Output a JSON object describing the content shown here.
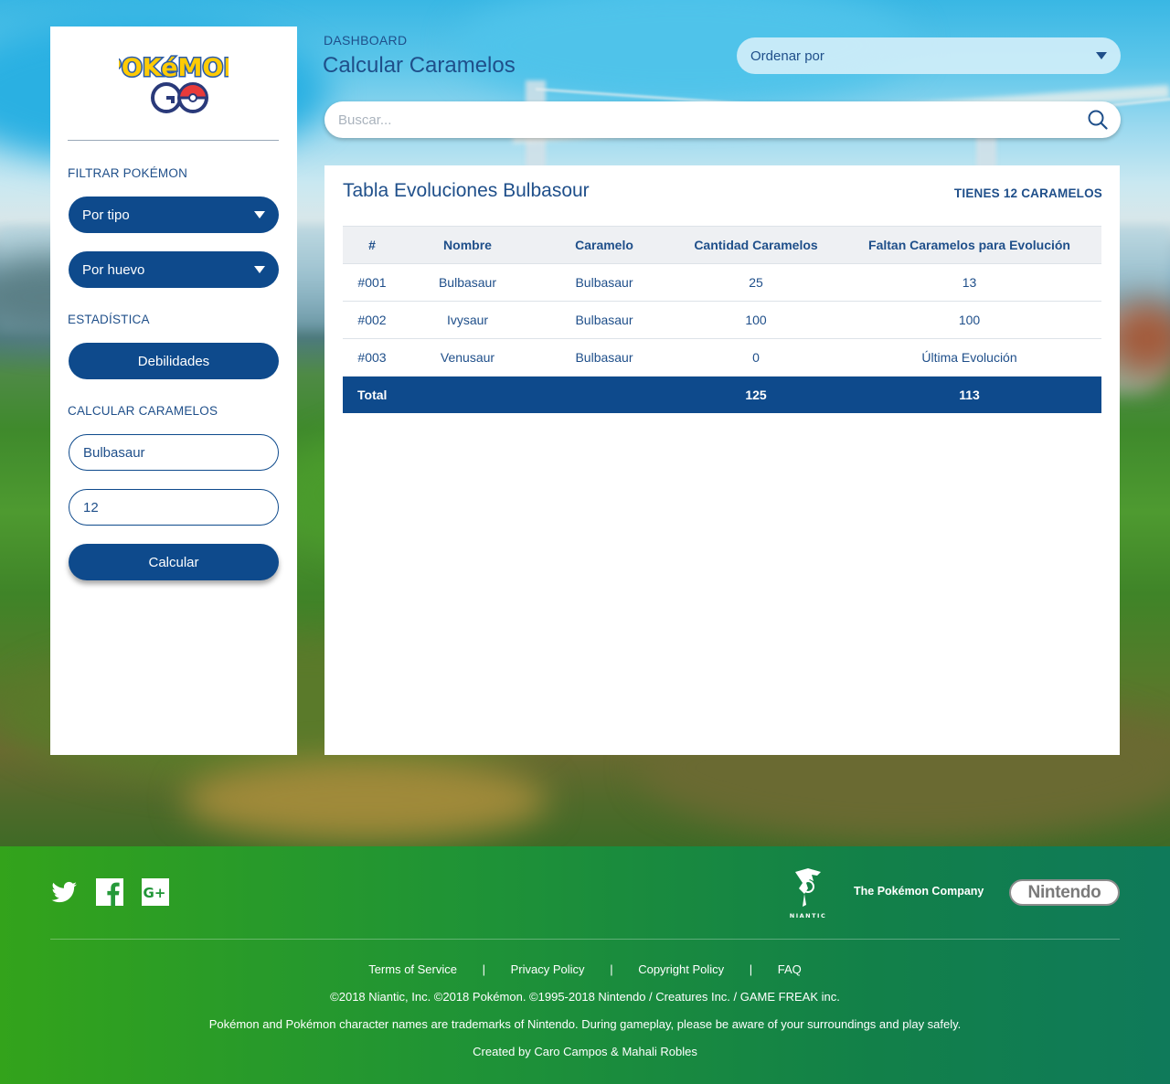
{
  "sidebar": {
    "logo_top": "POKéMON",
    "logo_bottom": "GO",
    "filter_heading": "FILTRAR POKÉMON",
    "filter_type_label": "Por tipo",
    "filter_egg_label": "Por huevo",
    "stats_heading": "ESTADÍSTICA",
    "weakness_button": "Debilidades",
    "candy_heading": "CALCULAR CARAMELOS",
    "pokemon_input_value": "Bulbasaur",
    "candy_input_value": "12",
    "calculate_button": "Calcular"
  },
  "header": {
    "breadcrumb": "DASHBOARD",
    "title": "Calcular Caramelos",
    "sort_label": "Ordenar por",
    "search_placeholder": "Buscar..."
  },
  "table": {
    "title": "Tabla Evoluciones Bulbasour",
    "candy_summary": "TIENES 12 CARAMELOS",
    "columns": [
      "#",
      "Nombre",
      "Caramelo",
      "Cantidad Caramelos",
      "Faltan Caramelos para Evolución"
    ],
    "rows": [
      [
        "#001",
        "Bulbasaur",
        "Bulbasaur",
        "25",
        "13"
      ],
      [
        "#002",
        "Ivysaur",
        "Bulbasaur",
        "100",
        "100"
      ],
      [
        "#003",
        "Venusaur",
        "Bulbasaur",
        "0",
        "Última Evolución"
      ]
    ],
    "total_label": "Total",
    "total_candies": "125",
    "total_missing": "113"
  },
  "footer": {
    "social_icons": [
      "twitter-icon",
      "facebook-icon",
      "google-plus-icon"
    ],
    "brands": {
      "niantic": "NIANTIC",
      "pokemon_company": "The Pokémon Company",
      "nintendo": "Nintendo"
    },
    "links": [
      "Terms of Service",
      "Privacy Policy",
      "Copyright Policy",
      "FAQ"
    ],
    "separator": "|",
    "copyright": "©2018 Niantic, Inc. ©2018 Pokémon. ©1995-2018 Nintendo / Creatures Inc. / GAME FREAK inc.",
    "trademark": "Pokémon and Pokémon character names are trademarks of Nintendo. During gameplay, please be aware of your surroundings and play safely.",
    "credits": "Created by Caro Campos & Mahali Robles"
  },
  "colors": {
    "primary": "#0e4a8c",
    "text": "#1f4f8a",
    "footer_start": "#33a31b",
    "footer_end": "#0f7a5a"
  }
}
